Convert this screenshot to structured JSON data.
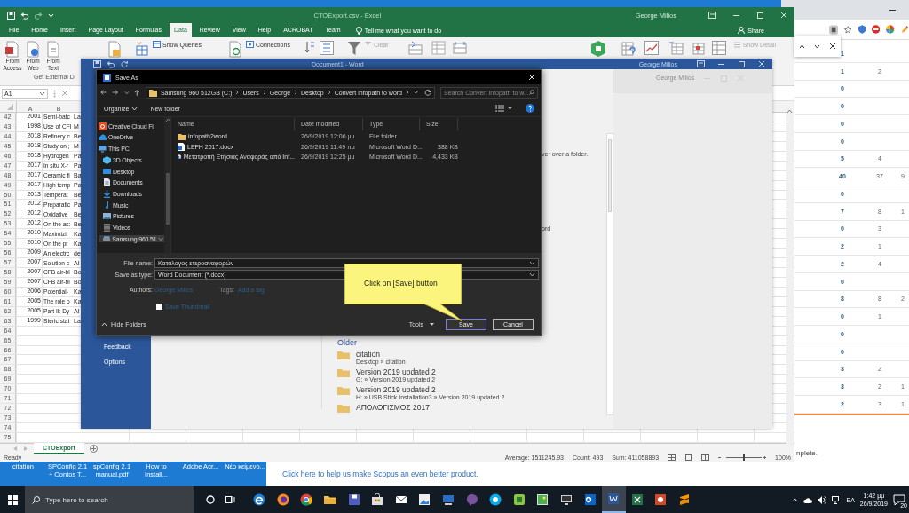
{
  "desktop_icons": [
    {
      "label": "citation"
    },
    {
      "label": "SPConfig 2.1 + Contos T..."
    },
    {
      "label": "spConfig 2.1 manual.pdf"
    },
    {
      "label": "How to Install..."
    },
    {
      "label": "Adobe Acr..."
    },
    {
      "label": "Νέο κείμενο..."
    }
  ],
  "scopus_window": {
    "link": "Click here to help us make Scopus an even better product."
  },
  "browser": {
    "rows": [
      [
        "1"
      ],
      [
        "1",
        "2"
      ],
      [
        "0"
      ],
      [
        "0"
      ],
      [
        "0"
      ],
      [
        "0"
      ],
      [
        "5",
        "4"
      ],
      [
        "40",
        "37",
        "9"
      ],
      [
        "0"
      ],
      [
        "7",
        "8",
        "1"
      ],
      [
        "0",
        "3"
      ],
      [
        "2",
        "1"
      ],
      [
        "2",
        "4"
      ],
      [
        "0"
      ],
      [
        "8",
        "8",
        "2"
      ],
      [
        "0",
        "1"
      ],
      [
        "0"
      ],
      [
        "0"
      ],
      [
        "3",
        "2"
      ],
      [
        "3",
        "2",
        "1"
      ],
      [
        "2",
        "3",
        "1"
      ]
    ],
    "footer_fragment": "nplete."
  },
  "excel": {
    "title": "CTOExport.csv - Excel",
    "user": "George Milios",
    "tabs": [
      {
        "label": "File",
        "selected": false
      },
      {
        "label": "Home",
        "selected": false
      },
      {
        "label": "Insert",
        "selected": false
      },
      {
        "label": "Page Layout",
        "selected": false
      },
      {
        "label": "Formulas",
        "selected": false
      },
      {
        "label": "Data",
        "selected": true
      },
      {
        "label": "Review",
        "selected": false
      },
      {
        "label": "View",
        "selected": false
      },
      {
        "label": "Help",
        "selected": false
      },
      {
        "label": "ACROBAT",
        "selected": false
      },
      {
        "label": "Team",
        "selected": false
      }
    ],
    "tell_me": "Tell me what you want to do",
    "share": "Share",
    "get_data_buttons": [
      "From Access",
      "From Web",
      "From Text"
    ],
    "group_label": "Get External D",
    "commands": [
      {
        "label": "Show Queries",
        "disabled": false
      },
      {
        "label": "Connections",
        "disabled": false
      },
      {
        "label": "Clear",
        "disabled": true
      },
      {
        "label": "Show Detail",
        "disabled": true
      }
    ],
    "name_box": "A1",
    "columns": [
      "A",
      "B"
    ],
    "rows": [
      {
        "number": "42",
        "cells": [
          "2001",
          "Semi-batc",
          "La"
        ]
      },
      {
        "number": "43",
        "cells": [
          "1998",
          "Use of CFI",
          "M"
        ]
      },
      {
        "number": "44",
        "cells": [
          "2018",
          "Refinery c",
          "Be"
        ]
      },
      {
        "number": "45",
        "cells": [
          "2018",
          "Study on ;",
          "M"
        ]
      },
      {
        "number": "46",
        "cells": [
          "2018",
          "Hydrogen",
          "Pa"
        ]
      },
      {
        "number": "47",
        "cells": [
          "2017",
          "In situ X-r",
          "Pa"
        ]
      },
      {
        "number": "48",
        "cells": [
          "2017",
          "Ceramic fi",
          "Ba"
        ]
      },
      {
        "number": "49",
        "cells": [
          "2017",
          "High temp",
          "Pa"
        ]
      },
      {
        "number": "50",
        "cells": [
          "2013",
          "Temperat",
          "Be"
        ]
      },
      {
        "number": "51",
        "cells": [
          "2012",
          "Preparatic",
          "Pa"
        ]
      },
      {
        "number": "52",
        "cells": [
          "2012",
          "Oxidative",
          "Be"
        ]
      },
      {
        "number": "53",
        "cells": [
          "2012",
          "On the as:",
          "Be"
        ]
      },
      {
        "number": "54",
        "cells": [
          "2010",
          "Maximizir",
          "Ka"
        ]
      },
      {
        "number": "55",
        "cells": [
          "2010",
          "On the pr",
          "Ka"
        ]
      },
      {
        "number": "56",
        "cells": [
          "2009",
          "An electrc",
          "de"
        ]
      },
      {
        "number": "57",
        "cells": [
          "2007",
          "Solution c",
          "Al"
        ]
      },
      {
        "number": "58",
        "cells": [
          "2007",
          "CFB air-bl",
          "Bo"
        ]
      },
      {
        "number": "59",
        "cells": [
          "2007",
          "CFB air-bl",
          "Bo"
        ]
      },
      {
        "number": "60",
        "cells": [
          "2006",
          "Potential-",
          "Ka"
        ]
      },
      {
        "number": "61",
        "cells": [
          "2005",
          "The role o",
          "Ka"
        ]
      },
      {
        "number": "62",
        "cells": [
          "2005",
          "Part II: Dy",
          "Al"
        ]
      },
      {
        "number": "63",
        "cells": [
          "1999",
          "Steric stat",
          "La"
        ]
      },
      {
        "number": "64"
      },
      {
        "number": "65"
      },
      {
        "number": "66"
      },
      {
        "number": "67"
      },
      {
        "number": "68"
      },
      {
        "number": "69"
      },
      {
        "number": "70"
      },
      {
        "number": "71"
      },
      {
        "number": "72"
      },
      {
        "number": "73"
      },
      {
        "number": "74"
      },
      {
        "number": "75"
      }
    ],
    "sheet_tabs": [
      {
        "label": "CTOExport",
        "selected": true
      }
    ],
    "status_bar": {
      "mode": "Ready",
      "average": "Average: 1511245.93",
      "count": "Count: 493",
      "sum": "Sum: 411058893",
      "zoom_slider": {
        "level": 0.5
      },
      "zoom": "100%"
    }
  },
  "word": {
    "title": "Document1 - Word",
    "user": "George Milios",
    "side_menu": [
      "Feedback",
      "Options"
    ],
    "fragments": [
      "ver over a folder.",
      "ord"
    ],
    "inner_user": "George Milios",
    "recent_heading": "Older",
    "recent": [
      {
        "name": "citation",
        "path": "Desktop » citation"
      },
      {
        "name": "Version 2019 updated 2",
        "path": "G: » Version 2019 updated 2"
      },
      {
        "name": "Version 2019 updated 2",
        "path": "H: » USB Stick Installation3 » Version 2019 updated 2"
      },
      {
        "name": "ΑΠΟΛΟΓΙΣΜΟΣ 2017"
      }
    ]
  },
  "save_dialog": {
    "title": "Save As",
    "breadcrumb": [
      "Samsung 960 512GB (C:)",
      "Users",
      "George",
      "Desktop",
      "Convert infopath to word"
    ],
    "search_placeholder": "Search Convert infopath to w...",
    "toolbar": [
      "Organize",
      "New folder"
    ],
    "nav": [
      {
        "label": "Creative Cloud Fil",
        "kind": "creative-cloud",
        "selected": false
      },
      {
        "label": "OneDrive",
        "kind": "onedrive",
        "selected": false
      },
      {
        "label": "This PC",
        "kind": "pc",
        "selected": false,
        "children": [
          {
            "label": "3D Objects",
            "kind": "objects",
            "selected": false
          },
          {
            "label": "Desktop",
            "kind": "desktop",
            "selected": false
          },
          {
            "label": "Documents",
            "kind": "documents",
            "selected": false
          },
          {
            "label": "Downloads",
            "kind": "downloads",
            "selected": false
          },
          {
            "label": "Music",
            "kind": "music",
            "selected": false
          },
          {
            "label": "Pictures",
            "kind": "pictures",
            "selected": false
          },
          {
            "label": "Videos",
            "kind": "videos",
            "selected": false
          },
          {
            "label": "Samsung 960 51",
            "kind": "disk",
            "selected": true
          }
        ]
      }
    ],
    "columns": [
      "Name",
      "Date modified",
      "Type",
      "Size"
    ],
    "files": [
      {
        "kind": "folder",
        "name": "infopath2word",
        "date": "26/9/2019 12:06 μμ",
        "type": "File folder"
      },
      {
        "kind": "docx",
        "name": "LEFH 2017.docx",
        "date": "26/9/2019 11:49 πμ",
        "type": "Microsoft Word D...",
        "size": "388 KB"
      },
      {
        "kind": "docx",
        "name": "Μετατροπή Ετήσιας Αναφοράς από Inf...",
        "date": "26/9/2019 12:25 μμ",
        "type": "Microsoft Word D...",
        "size": "4,433 KB"
      }
    ],
    "file_name_label": "File name:",
    "file_name": "Κατάλογος ετεροαναφορών",
    "type_label": "Save as type:",
    "type_value": "Word Document (*.docx)",
    "authors_label": "Authors:",
    "authors": "George Milios",
    "tags_label": "Tags:",
    "tags_placeholder": "Add a tag",
    "thumbnail": {
      "label": "Save Thumbnail",
      "checked": false
    },
    "hide_folders": "Hide Folders",
    "tools": "Tools",
    "save": "Save",
    "cancel": "Cancel"
  },
  "callout": {
    "text": "Click on [Save] button"
  },
  "taskbar": {
    "search_placeholder": "Type here to search",
    "apps": [
      {
        "kind": "edge",
        "selected": false
      },
      {
        "kind": "firefox",
        "selected": false
      },
      {
        "kind": "chrome",
        "selected": false
      },
      {
        "kind": "explorer",
        "selected": false
      },
      {
        "kind": "floppy",
        "selected": false
      },
      {
        "kind": "store",
        "selected": false
      },
      {
        "kind": "mail",
        "selected": false
      },
      {
        "kind": "paint",
        "selected": false
      },
      {
        "kind": "computer",
        "selected": false
      },
      {
        "kind": "viber",
        "selected": false
      },
      {
        "kind": "skype",
        "selected": false
      },
      {
        "kind": "green-tile",
        "selected": false
      },
      {
        "kind": "photos",
        "selected": false
      },
      {
        "kind": "monitor",
        "selected": false
      },
      {
        "kind": "outlook",
        "selected": false
      },
      {
        "kind": "word",
        "selected": true
      },
      {
        "kind": "excel",
        "selected": false
      },
      {
        "kind": "powerpoint",
        "selected": false
      },
      {
        "kind": "sublime",
        "selected": false
      }
    ],
    "language": "ΕΛ",
    "time": "1:42 μμ",
    "date": "26/9/2019",
    "notifications": "20"
  }
}
